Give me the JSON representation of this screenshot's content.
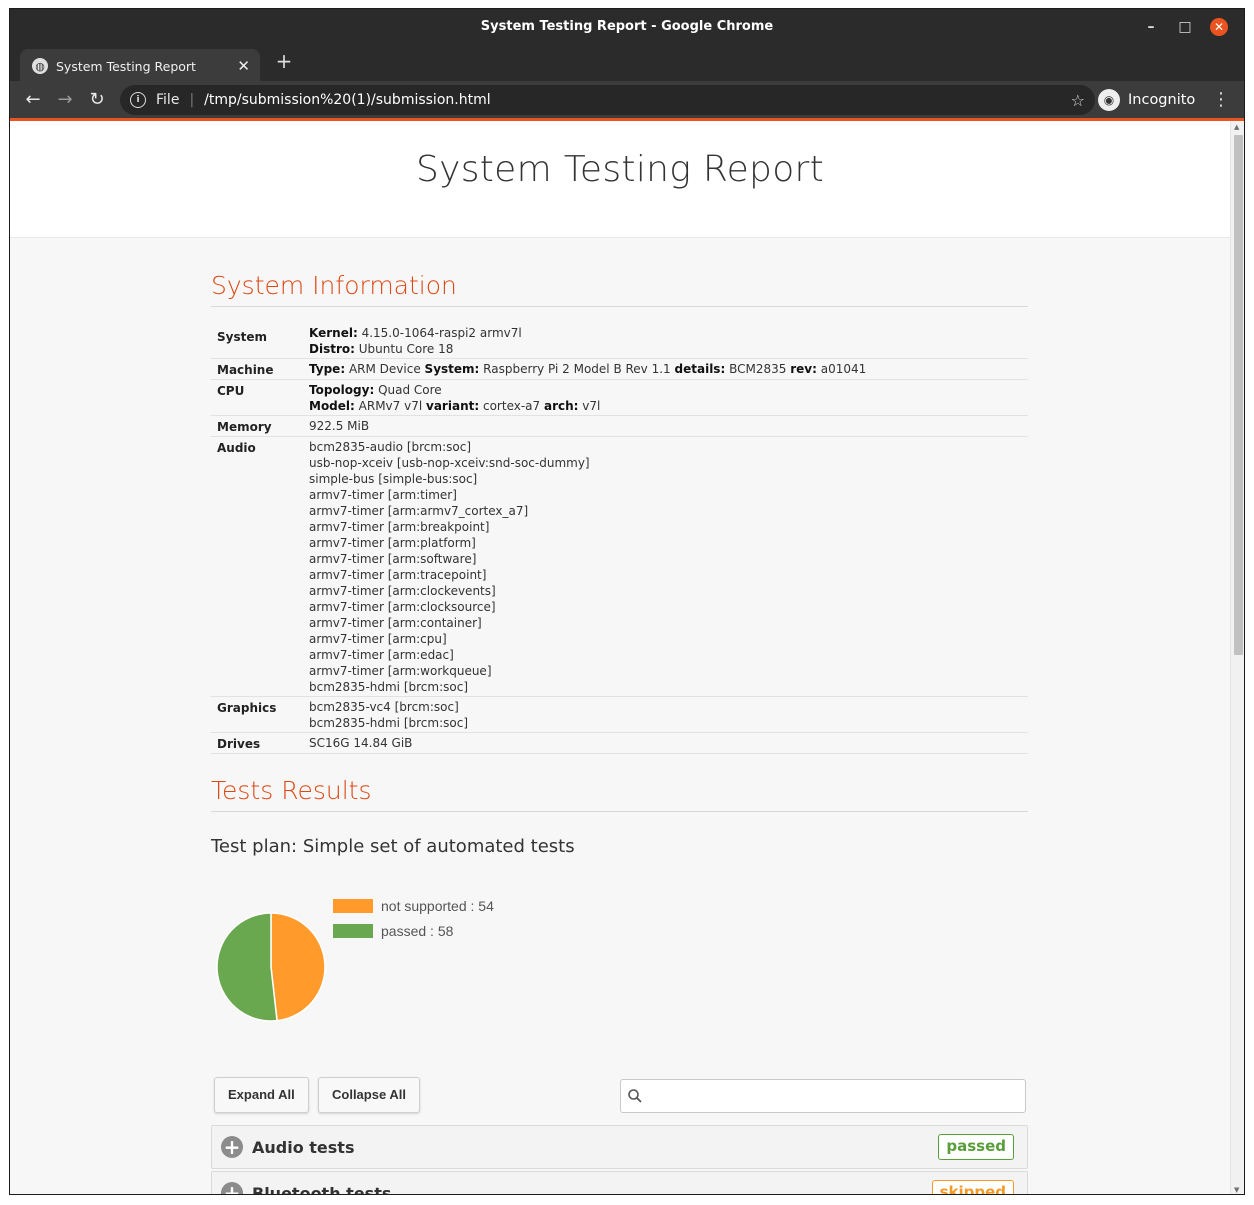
{
  "window": {
    "title": "System Testing Report - Google Chrome",
    "minimize_glyph": "–",
    "maximize_glyph": "□",
    "close_glyph": "✕"
  },
  "tab": {
    "title": "System Testing Report",
    "close_glyph": "✕",
    "new_tab_glyph": "+"
  },
  "toolbar": {
    "back_glyph": "←",
    "forward_glyph": "→",
    "reload_glyph": "↻",
    "scheme": "File",
    "url": "/tmp/submission%20(1)/submission.html",
    "star_glyph": "☆",
    "incognito_label": "Incognito",
    "menu_glyph": "⋮"
  },
  "page": {
    "title": "System Testing Report",
    "system_info_heading": "System Information",
    "tests_heading": "Tests Results",
    "test_plan": "Test plan: Simple set of automated tests"
  },
  "system_info": {
    "system": {
      "label": "System",
      "kernel_key": "Kernel:",
      "kernel": "4.15.0-1064-raspi2 armv7l",
      "distro_key": "Distro:",
      "distro": "Ubuntu Core 18"
    },
    "machine": {
      "label": "Machine",
      "type_key": "Type:",
      "type": "ARM Device",
      "system_key": "System:",
      "system": "Raspberry Pi 2 Model B Rev 1.1",
      "details_key": "details:",
      "details": "BCM2835",
      "rev_key": "rev:",
      "rev": "a01041"
    },
    "cpu": {
      "label": "CPU",
      "topology_key": "Topology:",
      "topology": "Quad Core",
      "model_key": "Model:",
      "model": "ARMv7 v7l",
      "variant_key": "variant:",
      "variant": "cortex-a7",
      "arch_key": "arch:",
      "arch": "v7l"
    },
    "memory": {
      "label": "Memory",
      "value": "922.5 MiB"
    },
    "audio": {
      "label": "Audio",
      "items": [
        "bcm2835-audio [brcm:soc]",
        "usb-nop-xceiv [usb-nop-xceiv:snd-soc-dummy]",
        "simple-bus [simple-bus:soc]",
        "armv7-timer [arm:timer]",
        "armv7-timer [arm:armv7_cortex_a7]",
        "armv7-timer [arm:breakpoint]",
        "armv7-timer [arm:platform]",
        "armv7-timer [arm:software]",
        "armv7-timer [arm:tracepoint]",
        "armv7-timer [arm:clockevents]",
        "armv7-timer [arm:clocksource]",
        "armv7-timer [arm:container]",
        "armv7-timer [arm:cpu]",
        "armv7-timer [arm:edac]",
        "armv7-timer [arm:workqueue]",
        "bcm2835-hdmi [brcm:soc]"
      ]
    },
    "graphics": {
      "label": "Graphics",
      "items": [
        "bcm2835-vc4 [brcm:soc]",
        "bcm2835-hdmi [brcm:soc]"
      ]
    },
    "drives": {
      "label": "Drives",
      "value": "SC16G 14.84 GiB"
    }
  },
  "chart_data": {
    "type": "pie",
    "categories": [
      "not supported",
      "passed"
    ],
    "values": [
      54,
      58
    ],
    "colors": [
      "#ff9a2b",
      "#6aa84f"
    ],
    "legend_labels": [
      "not supported : 54",
      "passed : 58"
    ],
    "legend_placement": "right"
  },
  "controls": {
    "expand_all": "Expand All",
    "collapse_all": "Collapse All",
    "search_placeholder": "",
    "search_icon": "search-icon"
  },
  "groups": [
    {
      "name": "Audio tests",
      "status": "passed",
      "status_color": "#5a9e3a"
    },
    {
      "name": "Bluetooth tests",
      "status": "skipped",
      "status_color": "#f39a26"
    }
  ],
  "colors": {
    "accent": "#e95420",
    "heading": "#dd4814"
  }
}
